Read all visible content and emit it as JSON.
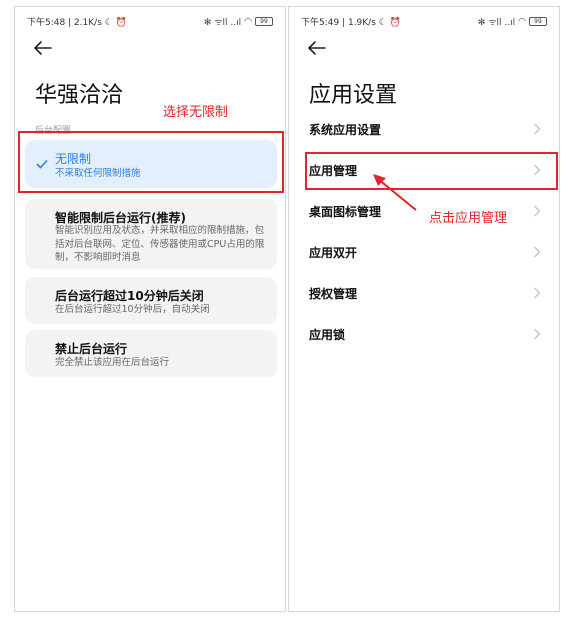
{
  "left": {
    "status": {
      "time_net": "下午5:48 | 2.1K/s",
      "moon": "☾",
      "alarm": "⏰",
      "right_icons": "✻ ᯤll ..ıl",
      "wifi": "◠",
      "battery": "99"
    },
    "title": "华强洽洽",
    "annotation": "选择无限制",
    "section_label": "后台配置",
    "options": [
      {
        "title": "无限制",
        "desc": "不采取任何限制措施"
      },
      {
        "title": "智能限制后台运行(推荐)",
        "desc": "智能识别应用及状态，并采取相应的限制措施，包括对后台联网、定位、传感器使用或CPU占用的限制，不影响即时消息"
      },
      {
        "title": "后台运行超过10分钟后关闭",
        "desc": "在后台运行超过10分钟后，自动关闭"
      },
      {
        "title": "禁止后台运行",
        "desc": "完全禁止该应用在后台运行"
      }
    ]
  },
  "right": {
    "status": {
      "time_net": "下午5:49 | 1.9K/s",
      "moon": "☾",
      "alarm": "⏰",
      "right_icons": "✻ ᯤll ..ıl",
      "wifi": "◠",
      "battery": "99"
    },
    "title": "应用设置",
    "annotation": "点击应用管理",
    "menu": [
      {
        "label": "系统应用设置"
      },
      {
        "label": "应用管理"
      },
      {
        "label": "桌面图标管理"
      },
      {
        "label": "应用双开"
      },
      {
        "label": "授权管理"
      },
      {
        "label": "应用锁"
      }
    ]
  },
  "colors": {
    "annotation_red": "#e0252b",
    "selected_blue": "#2a7ff0",
    "selected_bg": "#e3effd",
    "card_bg": "#f3f3f3"
  },
  "icons": [
    "back-arrow-icon",
    "check-icon",
    "chevron-right-icon",
    "bluetooth-icon",
    "signal-icon",
    "wifi-icon",
    "battery-icon",
    "moon-icon",
    "alarm-icon"
  ]
}
